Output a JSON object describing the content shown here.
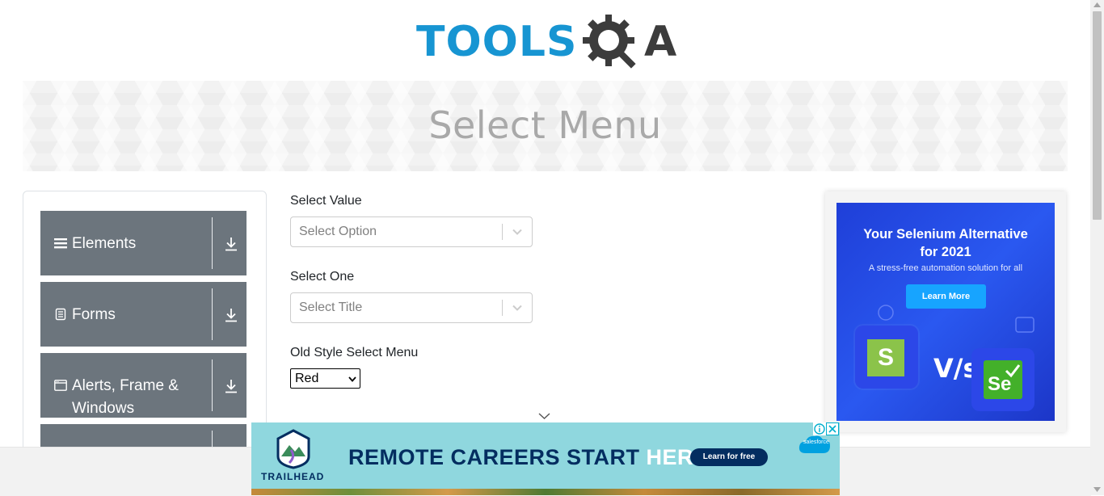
{
  "header": {
    "logo_main": "TOOLS",
    "logo_tail": "A"
  },
  "banner": {
    "title": "Select Menu"
  },
  "sidebar": {
    "groups": [
      {
        "label": "Elements",
        "icon": "hamburger-icon"
      },
      {
        "label": "Forms",
        "icon": "document-icon"
      },
      {
        "label": "Alerts, Frame & Windows",
        "icon": "window-icon"
      },
      {
        "label": "",
        "icon": ""
      }
    ]
  },
  "form": {
    "select_value": {
      "label": "Select Value",
      "placeholder": "Select Option"
    },
    "select_one": {
      "label": "Select One",
      "placeholder": "Select Title"
    },
    "old_style": {
      "label": "Old Style Select Menu",
      "selected": "Red"
    }
  },
  "side_ad": {
    "title_line1": "Your Selenium Alternative",
    "title_line2": "for 2021",
    "subtitle": "A stress-free automation solution for all",
    "cta": "Learn More",
    "versus": "V/s",
    "katalon_letter": "S",
    "selenium_letter": "Se"
  },
  "bottom_ad": {
    "brand": "TRAILHEAD",
    "headline_main": "REMOTE CAREERS START ",
    "headline_highlight": "HERE.",
    "cta": "Learn for free",
    "sponsor": "salesforce"
  },
  "colors": {
    "brand_blue": "#1795d2",
    "sidebar_group": "#6c757d",
    "ad_blue": "#2a58f0",
    "trailhead_bg": "#8fd7de"
  }
}
